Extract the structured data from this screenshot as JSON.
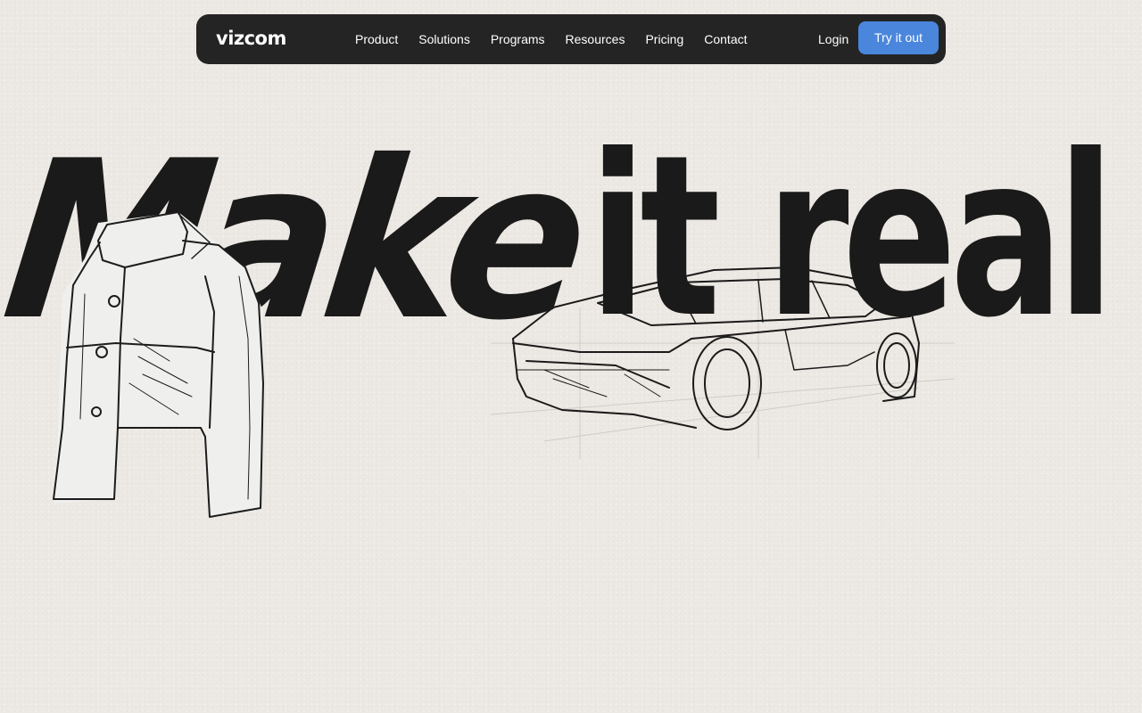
{
  "nav": {
    "logo": "vizcom",
    "links": [
      {
        "label": "Product"
      },
      {
        "label": "Solutions"
      },
      {
        "label": "Programs"
      },
      {
        "label": "Resources"
      },
      {
        "label": "Pricing"
      },
      {
        "label": "Contact"
      }
    ],
    "login": "Login",
    "cta": "Try it out"
  },
  "hero": {
    "headline_word1": "Make",
    "headline_word2": "it real"
  },
  "colors": {
    "background": "#ece8e3",
    "navbar": "#242424",
    "accent": "#4a86dc",
    "ink": "#1a1a1a"
  },
  "illustrations": {
    "jacket": "jacket-sketch",
    "car": "car-sketch"
  }
}
